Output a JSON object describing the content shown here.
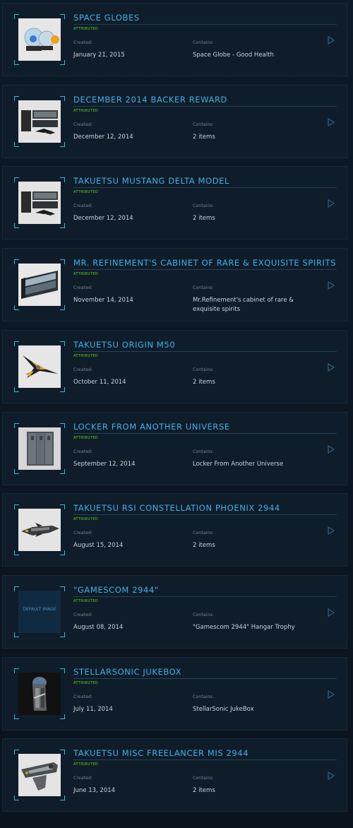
{
  "labels": {
    "attributed": "ATTRIBUTED",
    "created": "Created:",
    "contains": "Contains:",
    "default_image": "DEFAULT IMAGE"
  },
  "pledges": [
    {
      "title": "SPACE GLOBES",
      "created": "January 21, 2015",
      "contains": "Space Globe - Good Health",
      "thumb": "space-globes"
    },
    {
      "title": "DECEMBER 2014 BACKER REWARD",
      "created": "December 12, 2014",
      "contains": "2 items",
      "thumb": "mustang-model"
    },
    {
      "title": "TAKUETSU MUSTANG DELTA MODEL",
      "created": "December 12, 2014",
      "contains": "2 items",
      "thumb": "mustang-model"
    },
    {
      "title": "MR. REFINEMENT'S CABINET OF RARE & EXQUISITE SPIRITS",
      "created": "November 14, 2014",
      "contains": "Mr.Refinement's cabinet of rare & exquisite spirits",
      "thumb": "cabinet"
    },
    {
      "title": "TAKUETSU ORIGIN M50",
      "created": "October 11, 2014",
      "contains": "2 items",
      "thumb": "m50"
    },
    {
      "title": "LOCKER FROM ANOTHER UNIVERSE",
      "created": "September 12, 2014",
      "contains": "Locker From Another Universe",
      "thumb": "locker"
    },
    {
      "title": "TAKUETSU RSI CONSTELLATION PHOENIX 2944",
      "created": "August 15, 2014",
      "contains": "2 items",
      "thumb": "phoenix"
    },
    {
      "title": "\"GAMESCOM 2944\"",
      "created": "August 08, 2014",
      "contains": "\"Gamescom 2944\" Hangar Trophy",
      "thumb": "default"
    },
    {
      "title": "STELLARSONIC JUKEBOX",
      "created": "July 11, 2014",
      "contains": "StellarSonic JukeBox",
      "thumb": "jukebox"
    },
    {
      "title": "TAKUETSU MISC FREELANCER MIS 2944",
      "created": "June 13, 2014",
      "contains": "2 items",
      "thumb": "freelancer"
    }
  ]
}
